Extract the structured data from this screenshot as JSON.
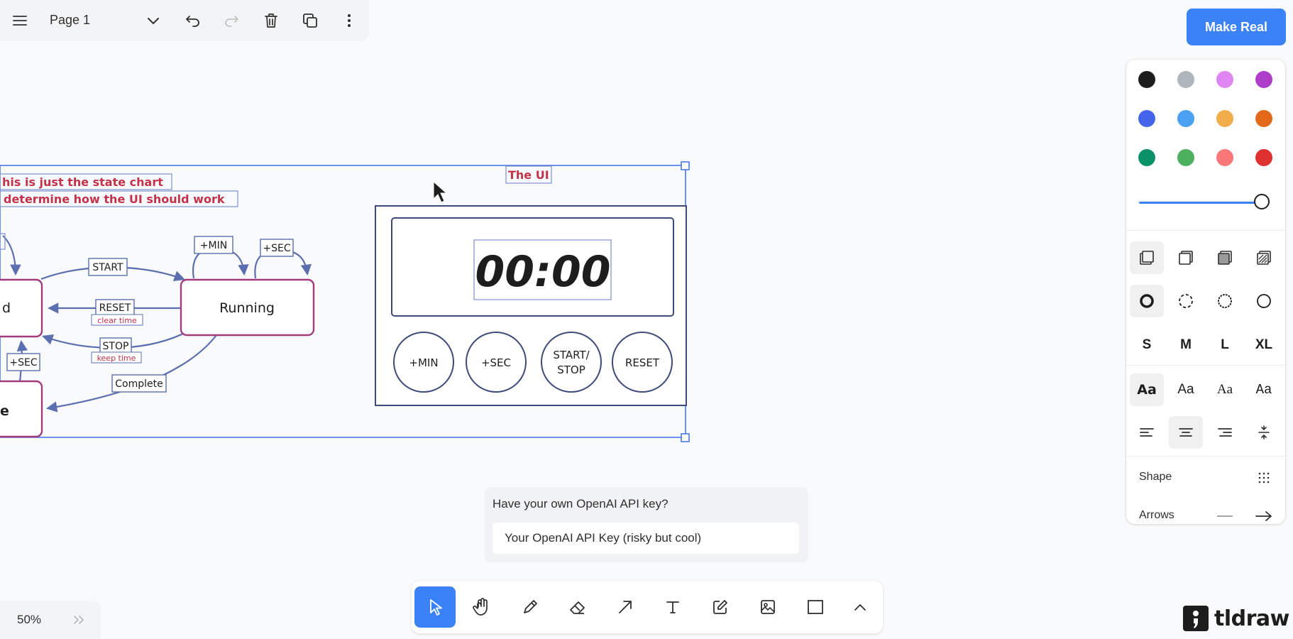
{
  "topbar": {
    "page_name": "Page 1"
  },
  "make_real": {
    "label": "Make Real"
  },
  "canvas": {
    "note_line1": "his is just the state chart",
    "note_line2": "determine how the UI should work",
    "ui_label": "The UI",
    "state_running": "Running",
    "state_idle_fragment": "d",
    "state_done_fragment": "e",
    "edge_start": "START",
    "edge_reset": "RESET",
    "edge_reset_note": "clear time",
    "edge_stop": "STOP",
    "edge_stop_note": "keep time",
    "edge_complete": "Complete",
    "loop_min": "+MIN",
    "loop_sec": "+SEC",
    "idle_sec": "+SEC",
    "timer_display": "00:00",
    "btn_min": "+MIN",
    "btn_sec": "+SEC",
    "btn_startstop_1": "START/",
    "btn_startstop_2": "STOP",
    "btn_reset": "RESET"
  },
  "style_panel": {
    "colors": [
      "#1d1d1d",
      "#adb5bd",
      "#e085f4",
      "#ae3ec9",
      "#4465e9",
      "#4ba1f1",
      "#f1ac4b",
      "#e16919",
      "#099268",
      "#4cb05e",
      "#f87777",
      "#e03131"
    ],
    "sizes": [
      "S",
      "M",
      "L",
      "XL"
    ],
    "font_sample": "Aa",
    "shape_label": "Shape",
    "arrows_label": "Arrows"
  },
  "api_key": {
    "title": "Have your own OpenAI API key?",
    "placeholder": "Your OpenAI API Key (risky but cool)"
  },
  "zoom": {
    "level": "50%"
  },
  "logo": {
    "text": "tldraw"
  }
}
